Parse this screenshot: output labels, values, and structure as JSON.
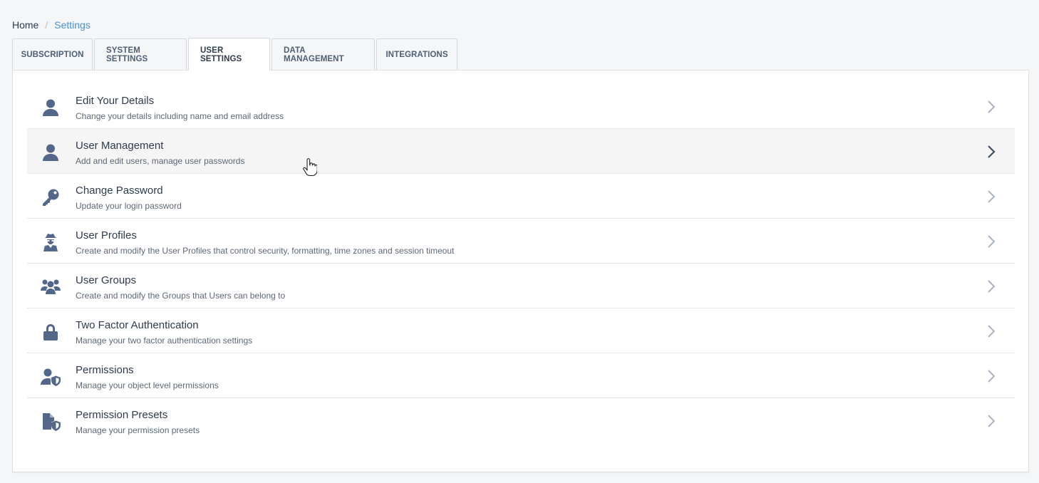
{
  "breadcrumb": {
    "home": "Home",
    "separator": "/",
    "current": "Settings"
  },
  "tabs": [
    {
      "label": "SUBSCRIPTION",
      "active": false
    },
    {
      "label": "SYSTEM SETTINGS",
      "active": false
    },
    {
      "label": "USER SETTINGS",
      "active": true
    },
    {
      "label": "DATA MANAGEMENT",
      "active": false
    },
    {
      "label": "INTEGRATIONS",
      "active": false
    }
  ],
  "colors": {
    "icon": "#52678a",
    "link": "#4a90d0",
    "hover_row": "#f5f5f5"
  },
  "items": [
    {
      "icon": "user-icon",
      "title": "Edit Your Details",
      "desc": "Change your details including name and email address"
    },
    {
      "icon": "user-icon",
      "title": "User Management",
      "desc": "Add and edit users, manage user passwords"
    },
    {
      "icon": "key-icon",
      "title": "Change Password",
      "desc": "Update your login password"
    },
    {
      "icon": "user-secret-icon",
      "title": "User Profiles",
      "desc": "Create and modify the User Profiles that control security, formatting, time zones and session timeout"
    },
    {
      "icon": "users-icon",
      "title": "User Groups",
      "desc": "Create and modify the Groups that Users can belong to"
    },
    {
      "icon": "lock-icon",
      "title": "Two Factor Authentication",
      "desc": "Manage your two factor authentication settings"
    },
    {
      "icon": "user-shield-icon",
      "title": "Permissions",
      "desc": "Manage your object level permissions"
    },
    {
      "icon": "file-shield-icon",
      "title": "Permission Presets",
      "desc": "Manage your permission presets"
    }
  ]
}
